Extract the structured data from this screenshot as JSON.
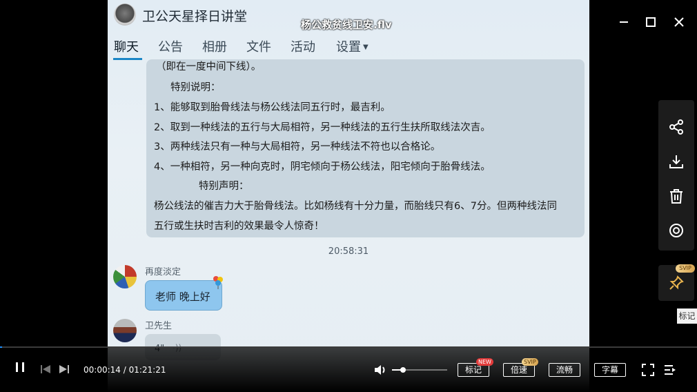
{
  "video_title": "杨公救贫线卫安.flv",
  "window_controls": {
    "minimize": "—",
    "maximize": "☐",
    "close": "✕"
  },
  "chat": {
    "group_name": "卫公天星择日讲堂",
    "tabs": [
      {
        "label": "聊天",
        "active": true
      },
      {
        "label": "公告"
      },
      {
        "label": "相册"
      },
      {
        "label": "文件"
      },
      {
        "label": "活动"
      },
      {
        "label": "设置"
      }
    ],
    "announcement_lines": [
      "（即在一度中间下线）。",
      "特别说明：",
      "1、能够取到胎骨线法与杨公线法同五行时，最吉利。",
      "2、取到一种线法的五行与大局相符，另一种线法的五行生扶所取线法次吉。",
      "3、两种线法只有一种与大局相符，另一种线法不符也以合格论。",
      "4、一种相符，另一种向克时，阴宅倾向于杨公线法，阳宅倾向于胎骨线法。",
      "特别声明：",
      "杨公线法的催吉力大于胎骨线法。比如杨线有十分力量，而胎线只有6、7分。但两种线法同",
      "五行或生扶时吉利的效果最令人惊奇！"
    ],
    "message_time": "20:58:31",
    "messages": [
      {
        "sender": "再度淡定",
        "text": "老师 晚上好"
      },
      {
        "sender": "卫先生",
        "text": "4\""
      }
    ]
  },
  "side_toolbar": {
    "icons": [
      "share-icon",
      "download-icon",
      "delete-icon",
      "watch-icon"
    ],
    "pin_badge": "SVIP",
    "tooltip": "标记"
  },
  "player": {
    "current_time": "00:00:14",
    "total_time": "01:21:21",
    "time_display": "00:00:14 / 01:21:21",
    "progress_fraction": 0.003,
    "volume_fraction": 0.2,
    "buttons": {
      "mark": "标记",
      "mark_badge": "NEW",
      "speed": "倍速",
      "speed_badge": "SVIP",
      "quality": "流畅",
      "subtitle": "字幕"
    },
    "accent_color": "#1e90ff"
  }
}
